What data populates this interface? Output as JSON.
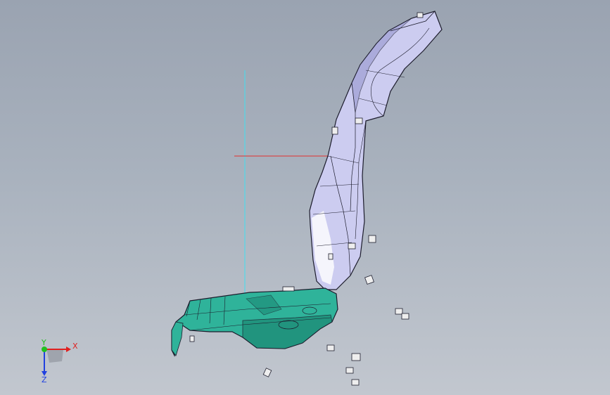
{
  "viewport": {
    "name": "cad-3d-viewport",
    "background_top": "#9aa3b1",
    "background_bottom": "#c2c7cf"
  },
  "model": {
    "backrest_color": "#ccccf0",
    "seat_color": "#2fb39a",
    "edge_color": "#1c1c2c",
    "clip_color": "#eeeeee"
  },
  "reference_lines": {
    "vertical_color": "#40e0f0",
    "horizontal_color": "#e03030"
  },
  "triad": {
    "x_label": "X",
    "y_label": "Y",
    "z_label": "Z",
    "x_color": "#e02020",
    "y_color": "#20c020",
    "z_color": "#2040e0"
  }
}
